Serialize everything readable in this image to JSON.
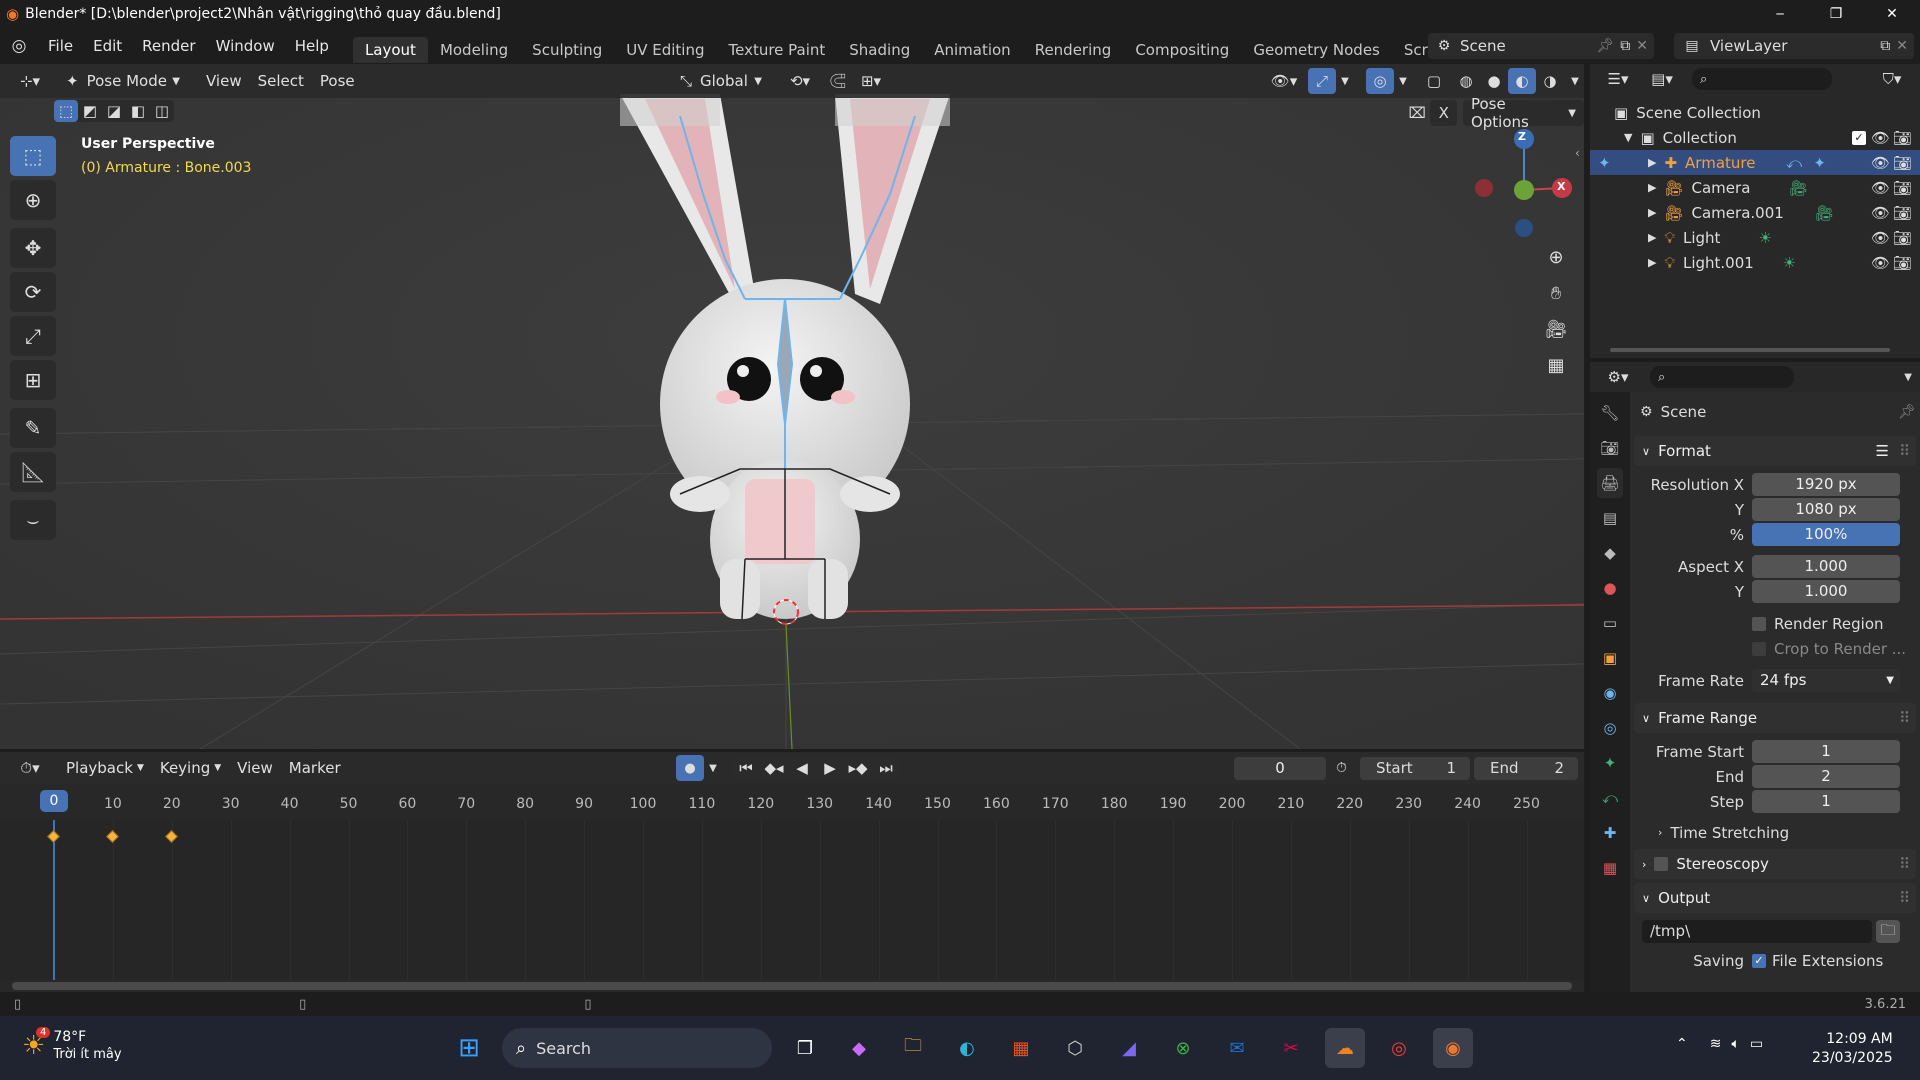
{
  "titlebar": {
    "title": "Blender* [D:\\blender\\project2\\Nhân vật\\rigging\\thỏ quay đầu.blend]",
    "minimize": "─",
    "maximize": "❐",
    "close": "✕"
  },
  "menu": {
    "items": [
      "File",
      "Edit",
      "Render",
      "Window",
      "Help"
    ]
  },
  "workspaces": {
    "tabs": [
      "Layout",
      "Modeling",
      "Sculpting",
      "UV Editing",
      "Texture Paint",
      "Shading",
      "Animation",
      "Rendering",
      "Compositing",
      "Geometry Nodes",
      "Scripting"
    ],
    "add": "+",
    "scene": "Scene",
    "viewlayer": "ViewLayer"
  },
  "viewport": {
    "mode": "Pose Mode",
    "menus": [
      "View",
      "Select",
      "Pose"
    ],
    "orientation": "Global",
    "perspective": "User Perspective",
    "active": "(0) Armature : Bone.003",
    "pose_options": "Pose Options",
    "x_label": "X",
    "gizmo": {
      "z": "Z",
      "x": "X"
    }
  },
  "outliner": {
    "scene_collection": "Scene Collection",
    "collection": "Collection",
    "items": [
      {
        "name": "Armature",
        "selected": true
      },
      {
        "name": "Camera",
        "selected": false
      },
      {
        "name": "Camera.001",
        "selected": false
      },
      {
        "name": "Light",
        "selected": false
      },
      {
        "name": "Light.001",
        "selected": false
      }
    ]
  },
  "properties": {
    "context": "Scene",
    "format_label": "Format",
    "res_x_label": "Resolution X",
    "res_x": "1920 px",
    "res_y_label": "Y",
    "res_y": "1080 px",
    "percent_label": "%",
    "percent": "100%",
    "aspect_x_label": "Aspect X",
    "aspect_x": "1.000",
    "aspect_y_label": "Y",
    "aspect_y": "1.000",
    "render_region": "Render Region",
    "crop": "Crop to Render ...",
    "frame_rate_label": "Frame Rate",
    "frame_rate": "24 fps",
    "frame_range_label": "Frame Range",
    "frame_start_label": "Frame Start",
    "frame_start": "1",
    "end_label": "End",
    "end": "2",
    "step_label": "Step",
    "step": "1",
    "time_stretching": "Time Stretching",
    "stereoscopy": "Stereoscopy",
    "output_label": "Output",
    "output_path": "/tmp\\",
    "saving_label": "Saving",
    "file_ext": "File Extensions"
  },
  "timeline": {
    "menus": [
      "Playback",
      "Keying",
      "View",
      "Marker"
    ],
    "current_frame": "0",
    "start_label": "Start",
    "start": "1",
    "end_label": "End",
    "end": "2",
    "ticks": [
      "0",
      "10",
      "20",
      "30",
      "40",
      "50",
      "60",
      "70",
      "80",
      "90",
      "100",
      "110",
      "120",
      "130",
      "140",
      "150",
      "160",
      "170",
      "180",
      "190",
      "200",
      "210",
      "220",
      "230",
      "240",
      "250"
    ],
    "keyframes": [
      0,
      10,
      20
    ]
  },
  "status": {
    "version": "3.6.21"
  },
  "taskbar": {
    "weather_temp": "78°F",
    "weather_desc": "Trời ít mây",
    "weather_badge": "4",
    "search": "Search",
    "time": "12:09 AM",
    "date": "23/03/2025"
  },
  "colors": {
    "accent": "#4772b3",
    "selected_text": "#f2a03d",
    "active_text": "#f2d94f",
    "keyframe": "#f4b43d"
  }
}
